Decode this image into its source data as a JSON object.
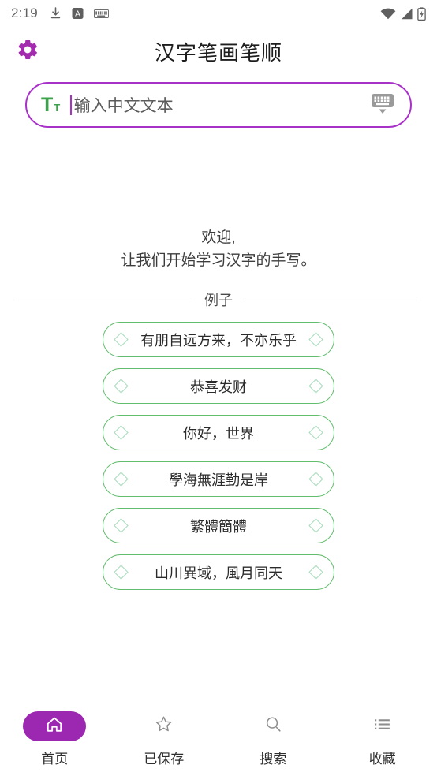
{
  "status_bar": {
    "time": "2:19",
    "left_icons": [
      "download-icon",
      "a-badge-icon",
      "keyboard-small-icon"
    ],
    "right_icons": [
      "wifi-icon",
      "signal-icon",
      "battery-charging-icon"
    ]
  },
  "app_bar": {
    "title": "汉字笔画笔顺",
    "settings_icon": "gear-icon"
  },
  "search": {
    "leading_icon": "text-format-icon",
    "leading_icon_big": "T",
    "leading_icon_small": "т",
    "placeholder": "输入中文文本",
    "value": "",
    "trailing_icon": "keyboard-icon",
    "accent_color": "#a832c8",
    "icon_color": "#3ca24b"
  },
  "welcome": {
    "line1": "欢迎,",
    "line2": "让我们开始学习汉字的手写。"
  },
  "examples_section": {
    "label": "例子",
    "chip_border_color": "#63bd6e",
    "items": [
      {
        "text": "有朋自远方来，不亦乐乎"
      },
      {
        "text": "恭喜发财"
      },
      {
        "text": "你好，世界"
      },
      {
        "text": "學海無涯勤是岸"
      },
      {
        "text": "繁體簡體"
      },
      {
        "text": "山川異域，風月同天"
      }
    ]
  },
  "bottom_nav": {
    "active_color": "#9c27b0",
    "items": [
      {
        "label": "首页",
        "icon": "home-icon",
        "active": true
      },
      {
        "label": "已保存",
        "icon": "star-icon",
        "active": false
      },
      {
        "label": "搜索",
        "icon": "search-icon",
        "active": false
      },
      {
        "label": "收藏",
        "icon": "list-icon",
        "active": false
      }
    ]
  }
}
